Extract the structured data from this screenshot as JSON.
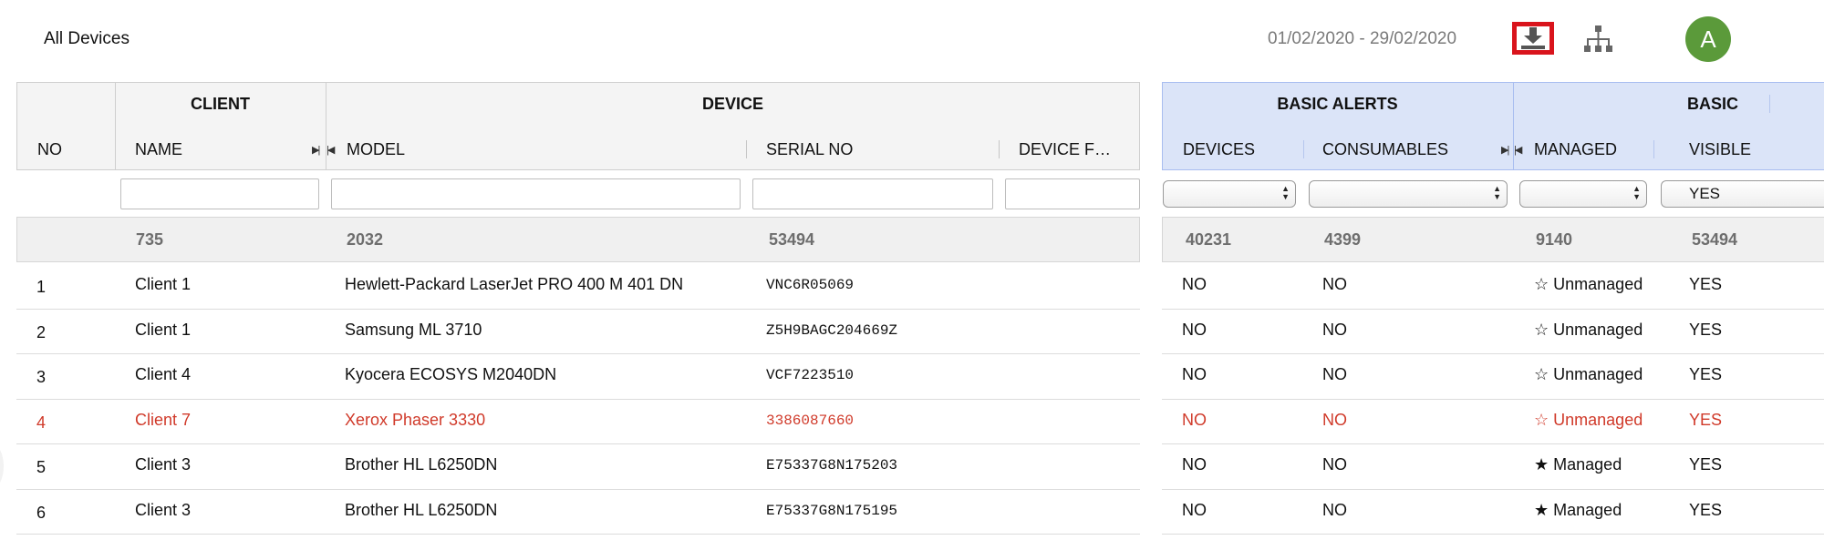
{
  "header": {
    "title": "All Devices",
    "date_range": "01/02/2020 - 29/02/2020",
    "avatar_letter": "A",
    "avatar_color": "#5b9a3a",
    "download_highlight_color": "#d9141c"
  },
  "groups": {
    "client": "CLIENT",
    "device": "DEVICE",
    "basic_alerts": "BASIC ALERTS",
    "basic": "BASIC"
  },
  "columns": {
    "no": "NO",
    "name": "NAME",
    "model": "MODEL",
    "serial": "SERIAL NO",
    "device_f": "DEVICE F…",
    "devices": "DEVICES",
    "consumables": "CONSUMABLES",
    "managed": "MANAGED",
    "visible": "VISIBLE"
  },
  "filters": {
    "visible_selected": "YES"
  },
  "totals": {
    "name": "735",
    "model": "2032",
    "serial": "53494",
    "devices": "40231",
    "consumables": "4399",
    "managed": "9140",
    "visible": "53494"
  },
  "rows": [
    {
      "no": "1",
      "client": "Client 1",
      "model": "Hewlett-Packard LaserJet PRO 400 M 401 DN",
      "serial": "VNC6R05069",
      "devices": "NO",
      "consumables": "NO",
      "managed_icon": "star-outline-icon",
      "managed": "Unmanaged",
      "visible": "YES",
      "highlight": false
    },
    {
      "no": "2",
      "client": "Client 1",
      "model": "Samsung ML 3710",
      "serial": "Z5H9BAGC204669Z",
      "devices": "NO",
      "consumables": "NO",
      "managed_icon": "star-outline-icon",
      "managed": "Unmanaged",
      "visible": "YES",
      "highlight": false
    },
    {
      "no": "3",
      "client": "Client 4",
      "model": "Kyocera ECOSYS M2040DN",
      "serial": "VCF7223510",
      "devices": "NO",
      "consumables": "NO",
      "managed_icon": "star-outline-icon",
      "managed": "Unmanaged",
      "visible": "YES",
      "highlight": false
    },
    {
      "no": "4",
      "client": "Client 7",
      "model": "Xerox Phaser 3330",
      "serial": "3386087660",
      "devices": "NO",
      "consumables": "NO",
      "managed_icon": "star-outline-icon",
      "managed": "Unmanaged",
      "visible": "YES",
      "highlight": true
    },
    {
      "no": "5",
      "client": "Client 3",
      "model": "Brother HL L6250DN",
      "serial": "E75337G8N175203",
      "devices": "NO",
      "consumables": "NO",
      "managed_icon": "star-filled-icon",
      "managed": "Managed",
      "visible": "YES",
      "highlight": false
    },
    {
      "no": "6",
      "client": "Client 3",
      "model": "Brother HL L6250DN",
      "serial": "E75337G8N175195",
      "devices": "NO",
      "consumables": "NO",
      "managed_icon": "star-filled-icon",
      "managed": "Managed",
      "visible": "YES",
      "highlight": false
    }
  ],
  "colors": {
    "highlight_row": "#d03a2a",
    "alerts_header_bg": "#dbe4f8"
  }
}
